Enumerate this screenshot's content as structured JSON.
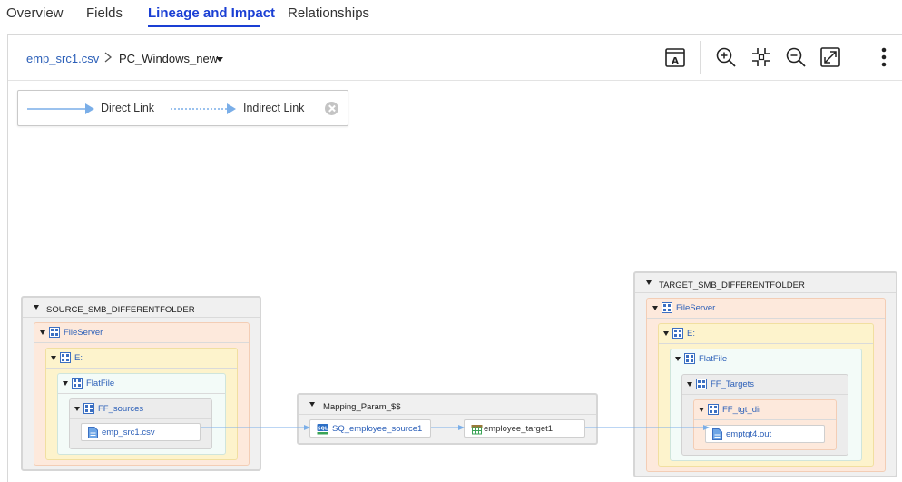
{
  "tabs": [
    {
      "label": "Overview",
      "active": false
    },
    {
      "label": "Fields",
      "active": false
    },
    {
      "label": "Lineage and Impact",
      "active": true
    },
    {
      "label": "Relationships",
      "active": false
    }
  ],
  "breadcrumb": {
    "source": "emp_src1.csv",
    "current": "PC_Windows_new"
  },
  "toolbar": {
    "icons": [
      "text-label-icon",
      "zoom-in-icon",
      "fit-to-screen-icon",
      "zoom-out-icon",
      "fullscreen-icon",
      "more-vertical-icon"
    ]
  },
  "legend": {
    "direct": "Direct Link",
    "indirect": "Indirect Link"
  },
  "colors": {
    "accent": "#1a3fd4",
    "link": "#2b5fb8",
    "edge": "#7aaee8"
  },
  "source": {
    "folder": "SOURCE_SMB_DIFFERENTFOLDER",
    "server": "FileServer",
    "drive": "E:",
    "type": "FlatFile",
    "container": "FF_sources",
    "file": "emp_src1.csv"
  },
  "mapping": {
    "name": "Mapping_Param_$$",
    "source_qualifier": "SQ_employee_source1",
    "target": "employee_target1"
  },
  "target": {
    "folder": "TARGET_SMB_DIFFERENTFOLDER",
    "server": "FileServer",
    "drive": "E:",
    "type": "FlatFile",
    "container": "FF_Targets",
    "dir": "FF_tgt_dir",
    "file": "emptgt4.out"
  }
}
